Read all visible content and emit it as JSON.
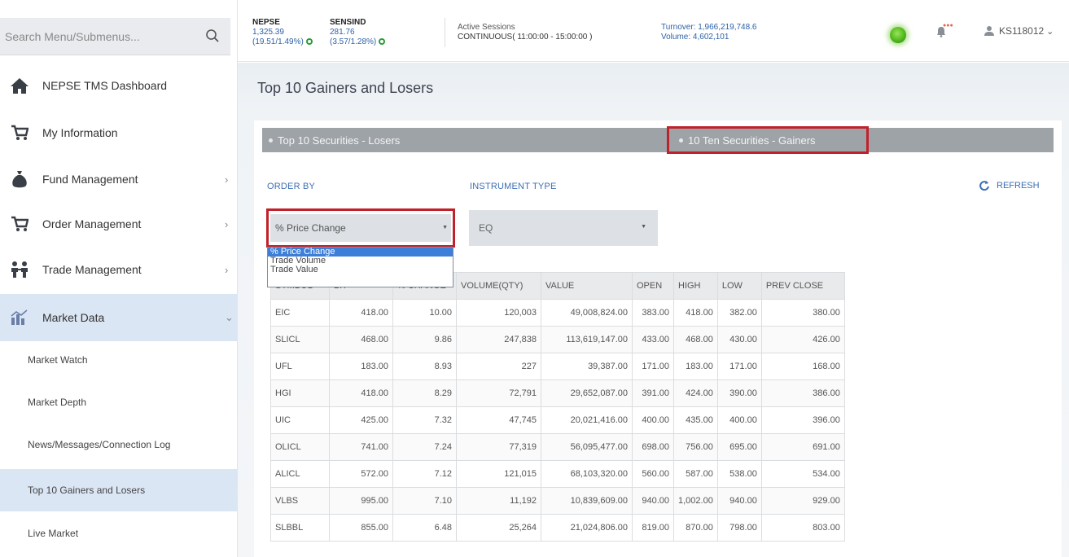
{
  "sidebar": {
    "search_placeholder": "Search Menu/Submenus...",
    "items": [
      {
        "label": "NEPSE TMS Dashboard"
      },
      {
        "label": "My Information"
      },
      {
        "label": "Fund Management"
      },
      {
        "label": "Order Management"
      },
      {
        "label": "Trade Management"
      },
      {
        "label": "Market Data"
      }
    ],
    "subitems": [
      {
        "label": "Market Watch"
      },
      {
        "label": "Market Depth"
      },
      {
        "label": "News/Messages/Connection Log"
      },
      {
        "label": "Top 10 Gainers and Losers"
      },
      {
        "label": "Live Market"
      }
    ]
  },
  "header": {
    "nepse": {
      "name": "NEPSE",
      "value": "1,325.39",
      "change": "(19.51/1.49%)"
    },
    "sensind": {
      "name": "SENSIND",
      "value": "281.76",
      "change": "(3.57/1.28%)"
    },
    "sessions_label": "Active Sessions",
    "sessions_state": "CONTINUOUS( 11:00:00 - 15:00:00 )",
    "turnover": "Turnover: 1,966,219,748.6",
    "volume": "Volume: 4,602,101",
    "user": "KS118012"
  },
  "main": {
    "title": "Top 10 Gainers and Losers",
    "tabs": {
      "losers": "Top 10 Securities - Losers",
      "gainers": "10 Ten Securities - Gainers"
    },
    "order_by_label": "ORDER BY",
    "instrument_label": "INSTRUMENT TYPE",
    "refresh_label": "REFRESH",
    "order_by_value": "% Price Change",
    "order_by_options": [
      "% Price Change",
      "Trade Volume",
      "Trade Value"
    ],
    "instrument_value": "EQ"
  },
  "table": {
    "columns": [
      "SYMBOL",
      "LTP",
      "% CHANGE",
      "VOLUME(QTY)",
      "VALUE",
      "OPEN",
      "HIGH",
      "LOW",
      "PREV CLOSE"
    ],
    "rows": [
      [
        "EIC",
        "418.00",
        "10.00",
        "120,003",
        "49,008,824.00",
        "383.00",
        "418.00",
        "382.00",
        "380.00"
      ],
      [
        "SLICL",
        "468.00",
        "9.86",
        "247,838",
        "113,619,147.00",
        "433.00",
        "468.00",
        "430.00",
        "426.00"
      ],
      [
        "UFL",
        "183.00",
        "8.93",
        "227",
        "39,387.00",
        "171.00",
        "183.00",
        "171.00",
        "168.00"
      ],
      [
        "HGI",
        "418.00",
        "8.29",
        "72,791",
        "29,652,087.00",
        "391.00",
        "424.00",
        "390.00",
        "386.00"
      ],
      [
        "UIC",
        "425.00",
        "7.32",
        "47,745",
        "20,021,416.00",
        "400.00",
        "435.00",
        "400.00",
        "396.00"
      ],
      [
        "OLICL",
        "741.00",
        "7.24",
        "77,319",
        "56,095,477.00",
        "698.00",
        "756.00",
        "695.00",
        "691.00"
      ],
      [
        "ALICL",
        "572.00",
        "7.12",
        "121,015",
        "68,103,320.00",
        "560.00",
        "587.00",
        "538.00",
        "534.00"
      ],
      [
        "VLBS",
        "995.00",
        "7.10",
        "11,192",
        "10,839,609.00",
        "940.00",
        "1,002.00",
        "940.00",
        "929.00"
      ],
      [
        "SLBBL",
        "855.00",
        "6.48",
        "25,264",
        "21,024,806.00",
        "819.00",
        "870.00",
        "798.00",
        "803.00"
      ]
    ]
  }
}
